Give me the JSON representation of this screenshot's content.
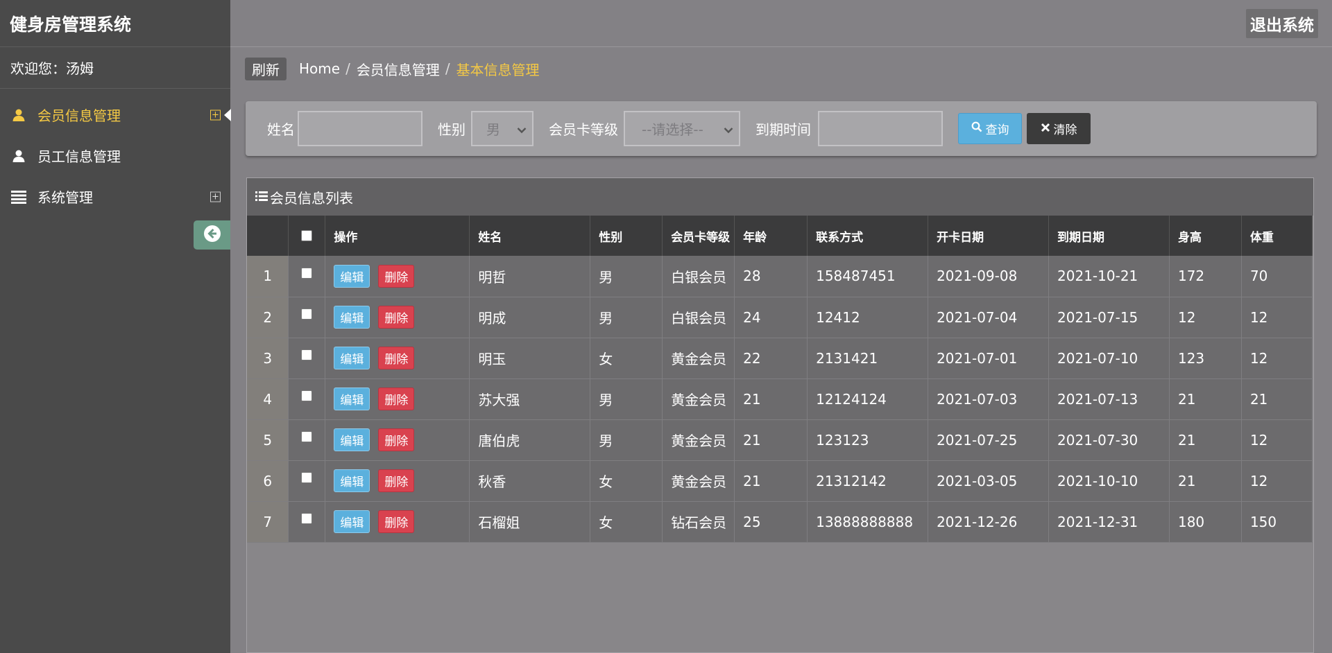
{
  "app": {
    "title": "健身房管理系统",
    "logout_label": "退出系统",
    "welcome": "欢迎您：汤姆"
  },
  "sidebar": {
    "items": [
      {
        "label": "会员信息管理",
        "icon": "user-icon",
        "active": true,
        "expandable": true
      },
      {
        "label": "员工信息管理",
        "icon": "user-icon",
        "active": false,
        "expandable": false
      },
      {
        "label": "系统管理",
        "icon": "list-icon",
        "active": false,
        "expandable": true
      }
    ]
  },
  "breadcrumb": {
    "refresh_label": "刷新",
    "home": "Home",
    "level1": "会员信息管理",
    "current": "基本信息管理",
    "separator": "/"
  },
  "search": {
    "name_label": "姓名",
    "name_value": "",
    "gender_label": "性别",
    "gender_value": "男",
    "level_label": "会员卡等级",
    "level_value": "--请选择--",
    "expire_label": "到期时间",
    "expire_value": "",
    "query_label": "查询",
    "clear_label": "清除"
  },
  "list": {
    "title": "会员信息列表",
    "columns": [
      "",
      "",
      "操作",
      "姓名",
      "性别",
      "会员卡等级",
      "年龄",
      "联系方式",
      "开卡日期",
      "到期日期",
      "身高",
      "体重"
    ],
    "edit_label": "编辑",
    "delete_label": "删除",
    "rows": [
      {
        "idx": "1",
        "name": "明哲",
        "gender": "男",
        "level": "白银会员",
        "age": "28",
        "phone": "158487451",
        "start": "2021-09-08",
        "end": "2021-10-21",
        "height": "172",
        "weight": "70"
      },
      {
        "idx": "2",
        "name": "明成",
        "gender": "男",
        "level": "白银会员",
        "age": "24",
        "phone": "12412",
        "start": "2021-07-04",
        "end": "2021-07-15",
        "height": "12",
        "weight": "12"
      },
      {
        "idx": "3",
        "name": "明玉",
        "gender": "女",
        "level": "黄金会员",
        "age": "22",
        "phone": "2131421",
        "start": "2021-07-01",
        "end": "2021-07-10",
        "height": "123",
        "weight": "12"
      },
      {
        "idx": "4",
        "name": "苏大强",
        "gender": "男",
        "level": "黄金会员",
        "age": "21",
        "phone": "12124124",
        "start": "2021-07-03",
        "end": "2021-07-13",
        "height": "21",
        "weight": "21"
      },
      {
        "idx": "5",
        "name": "唐伯虎",
        "gender": "男",
        "level": "黄金会员",
        "age": "21",
        "phone": "123123",
        "start": "2021-07-25",
        "end": "2021-07-30",
        "height": "21",
        "weight": "12"
      },
      {
        "idx": "6",
        "name": "秋香",
        "gender": "女",
        "level": "黄金会员",
        "age": "21",
        "phone": "21312142",
        "start": "2021-03-05",
        "end": "2021-10-10",
        "height": "21",
        "weight": "12"
      },
      {
        "idx": "7",
        "name": "石榴姐",
        "gender": "女",
        "level": "钻石会员",
        "age": "25",
        "phone": "13888888888",
        "start": "2021-12-26",
        "end": "2021-12-31",
        "height": "180",
        "weight": "150"
      }
    ]
  },
  "colors": {
    "accent": "#f5c944",
    "sidebar_bg": "#4a4a4a",
    "content_bg": "#838185",
    "edit_btn": "#5bb0dd",
    "delete_btn": "#d9424f"
  }
}
